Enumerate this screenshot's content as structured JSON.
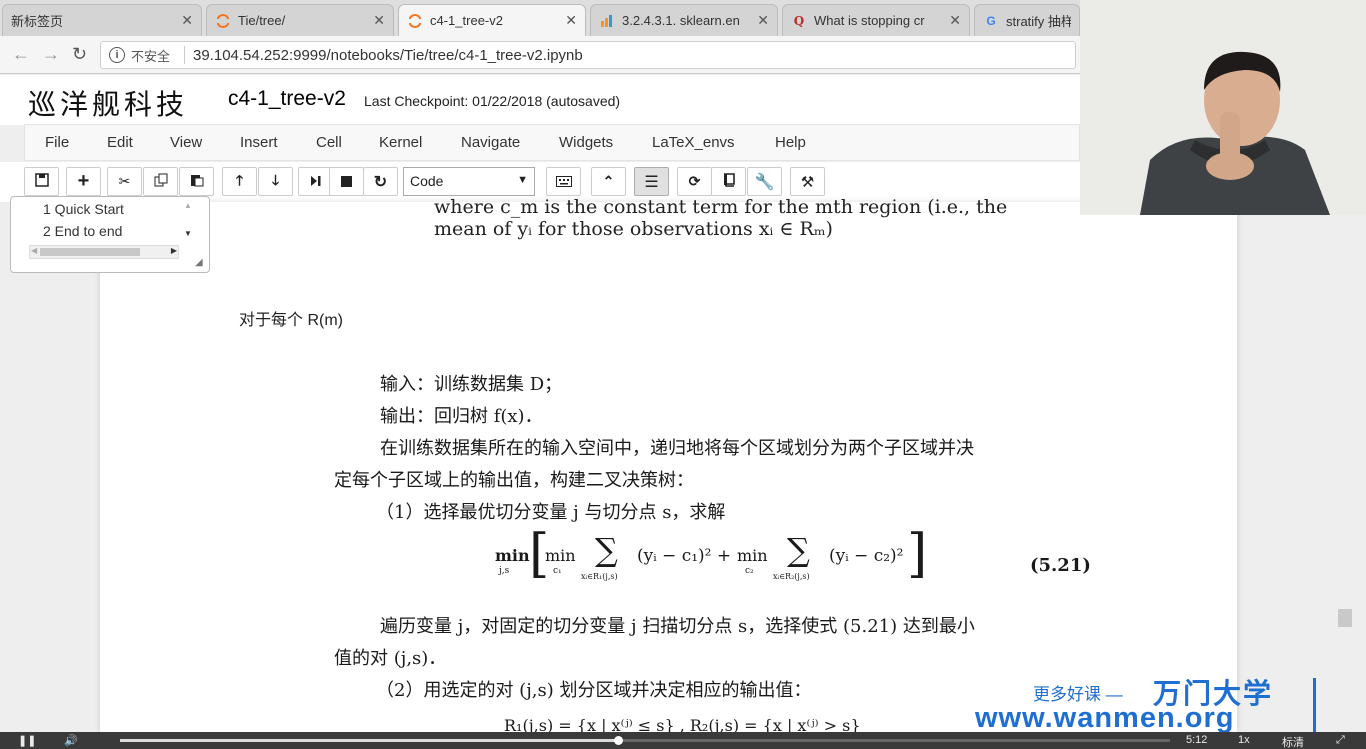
{
  "tabs": [
    {
      "title": "新标签页",
      "active": false
    },
    {
      "title": "Tie/tree/",
      "active": false,
      "icon": "jupyter-icon"
    },
    {
      "title": "c4-1_tree-v2",
      "active": true,
      "icon": "jupyter-icon"
    },
    {
      "title": "3.2.4.3.1. sklearn.en",
      "active": false,
      "icon": "sklearn-icon"
    },
    {
      "title": "What is stopping cr",
      "active": false,
      "icon": "quora-icon"
    },
    {
      "title": "stratify 抽样",
      "active": false,
      "icon": "google-icon"
    }
  ],
  "address": {
    "security": "不安全",
    "url": "39.104.54.252:9999/notebooks/Tie/tree/c4-1_tree-v2.ipynb"
  },
  "header": {
    "logo": "巡洋舰科技",
    "notebook_name": "c4-1_tree-v2",
    "checkpoint": "Last Checkpoint: 01/22/2018 (autosaved)"
  },
  "menu": [
    "File",
    "Edit",
    "View",
    "Insert",
    "Cell",
    "Kernel",
    "Navigate",
    "Widgets",
    "LaTeX_envs",
    "Help"
  ],
  "toolbar": {
    "cell_type": "Code"
  },
  "toc": {
    "items": [
      "1  Quick Start",
      "2  End to end"
    ]
  },
  "notebook": {
    "eq_tail_1": "where c_m is the constant term for the mth region (i.e., the",
    "eq_tail_2": "mean of yᵢ for those observations xᵢ ∈ Rₘ)",
    "heading": "对于每个 R(m)"
  },
  "book": {
    "line1": "输入：训练数据集 D；",
    "line2": "输出：回归树 f(x)．",
    "line3": "在训练数据集所在的输入空间中，递归地将每个区域划分为两个子区域并决",
    "line4": "定每个子区域上的输出值，构建二叉决策树：",
    "line5": "（1）选择最优切分变量 j 与切分点 s，求解",
    "formula_min_js": "min",
    "formula_sub_js": "j,s",
    "formula_min": "min",
    "formula_c1": "c₁",
    "formula_c2": "c₂",
    "formula_sum_r1": "xᵢ∈R₁(j,s)",
    "formula_sum_r2": "xᵢ∈R₂(j,s)",
    "formula_term1": "(yᵢ − c₁)² +",
    "formula_term2": "(yᵢ − c₂)²",
    "equation_number": "(5.21)",
    "line6": "遍历变量 j，对固定的切分变量 j 扫描切分点 s，选择使式 (5.21) 达到最小",
    "line7": "值的对 (j,s)．",
    "line8": "（2）用选定的对 (j,s) 划分区域并决定相应的输出值：",
    "line9": "R₁(j,s) = {x | x⁽ʲ⁾ ≤ s} ,   R₂(j,s) = {x | x⁽ʲ⁾ > s}"
  },
  "watermark": {
    "slogan": "更多好课 —",
    "brand": "万门大学",
    "url": "www.wanmen.org"
  },
  "player": {
    "time": "5:12",
    "speed": "1x",
    "quality": "标清"
  }
}
